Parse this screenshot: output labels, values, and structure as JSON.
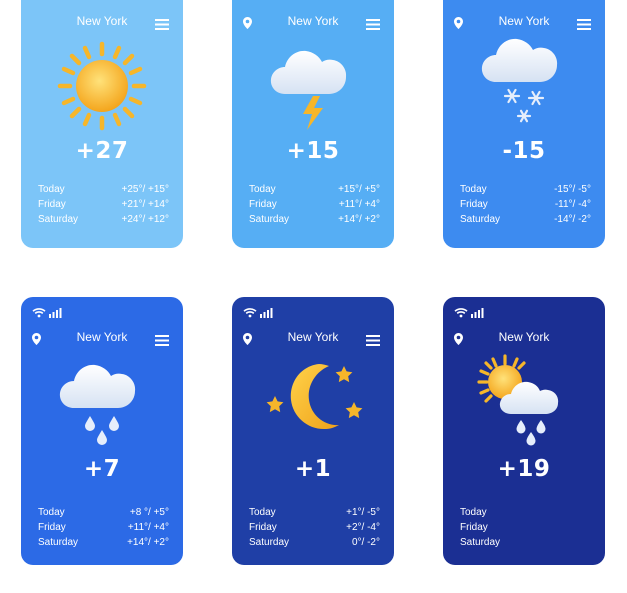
{
  "colors": {
    "card1": "#7cc5f8",
    "card2": "#56aef4",
    "card3": "#3d8bf0",
    "card4": "#2c6ae6",
    "card5": "#1f3fa6",
    "card6": "#1b2f93",
    "sun": "#f6b62a",
    "cloud": "#eef3fb"
  },
  "cards": [
    {
      "city": "New York",
      "condition_icon": "sun-icon",
      "temperature": "+27",
      "forecast": [
        {
          "day": "Today",
          "temps": "+25°/ +15°"
        },
        {
          "day": "Friday",
          "temps": "+21°/ +14°"
        },
        {
          "day": "Saturday",
          "temps": "+24°/ +12°"
        }
      ]
    },
    {
      "city": "New York",
      "condition_icon": "thunderstorm-icon",
      "temperature": "+15",
      "forecast": [
        {
          "day": "Today",
          "temps": "+15°/ +5°"
        },
        {
          "day": "Friday",
          "temps": "+11°/ +4°"
        },
        {
          "day": "Saturday",
          "temps": "+14°/ +2°"
        }
      ]
    },
    {
      "city": "New York",
      "condition_icon": "snow-icon",
      "temperature": "-15",
      "forecast": [
        {
          "day": "Today",
          "temps": "-15°/ -5°"
        },
        {
          "day": "Friday",
          "temps": "-11°/ -4°"
        },
        {
          "day": "Saturday",
          "temps": "-14°/ -2°"
        }
      ]
    },
    {
      "city": "New York",
      "condition_icon": "rain-icon",
      "temperature": "+7",
      "forecast": [
        {
          "day": "Today",
          "temps": "+8 °/ +5°"
        },
        {
          "day": "Friday",
          "temps": "+11°/ +4°"
        },
        {
          "day": "Saturday",
          "temps": "+14°/ +2°"
        }
      ]
    },
    {
      "city": "New York",
      "condition_icon": "moon-stars-icon",
      "temperature": "+1",
      "forecast": [
        {
          "day": "Today",
          "temps": "+1°/ -5°"
        },
        {
          "day": "Friday",
          "temps": "+2°/ -4°"
        },
        {
          "day": "Saturday",
          "temps": "0°/ -2°"
        }
      ]
    },
    {
      "city": "New York",
      "condition_icon": "partly-cloudy-rain-icon",
      "temperature": "+19",
      "forecast": [
        {
          "day": "Today",
          "temps": ""
        },
        {
          "day": "Friday",
          "temps": ""
        },
        {
          "day": "Saturday",
          "temps": ""
        }
      ]
    }
  ]
}
